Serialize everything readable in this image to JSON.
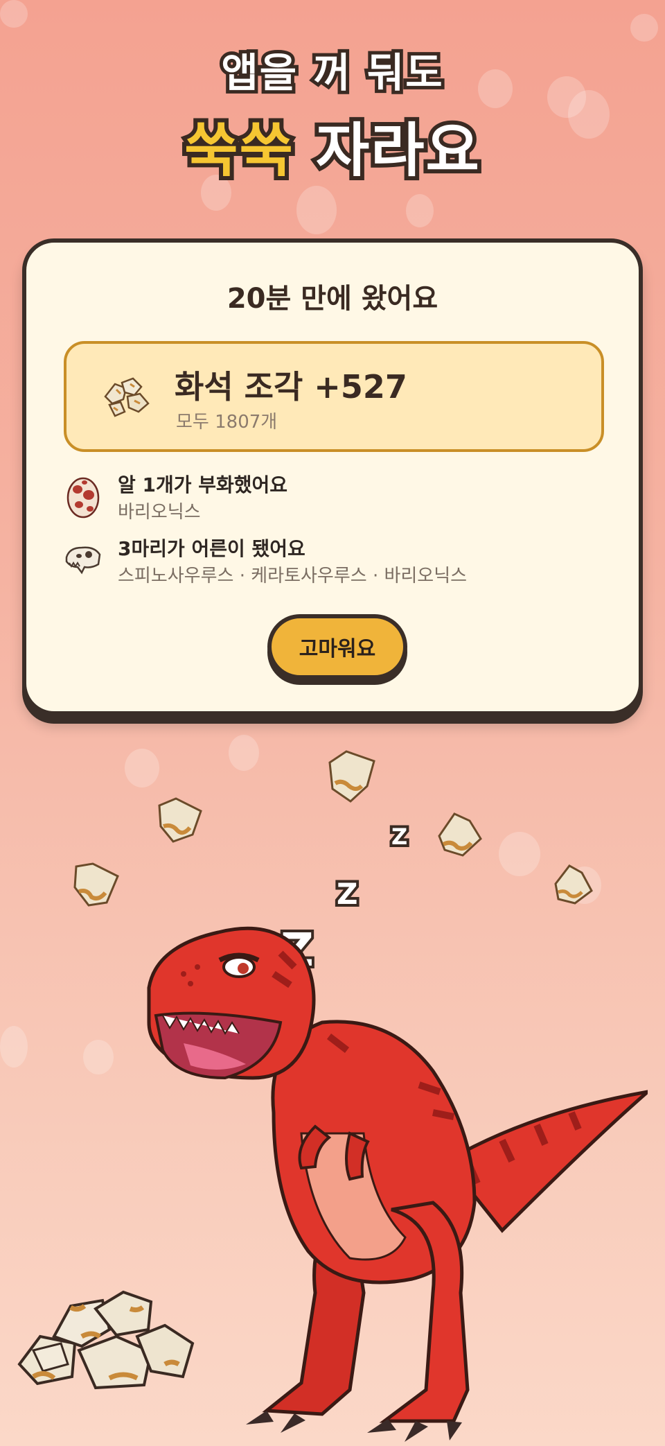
{
  "headline": {
    "line1": "앱을 꺼 둬도",
    "line2_highlight": "쑥쑥",
    "line2_rest": "자라요"
  },
  "card": {
    "title": "20분 만에 왔어요",
    "reward": {
      "icon": "fossil-piece-icon",
      "amount_label": "화석 조각 +527",
      "total_label": "모두 1807개"
    },
    "events": [
      {
        "icon": "egg-icon",
        "title": "알 1개가 부화했어요",
        "subtitle": "바리오닉스"
      },
      {
        "icon": "dino-skull-icon",
        "title": "3마리가 어른이 됐어요",
        "subtitle": "스피노사우루스 · 케라토사우루스 · 바리오닉스"
      }
    ],
    "button_label": "고마워요"
  },
  "sleep": {
    "z_large": "Z",
    "z_medium": "Z",
    "z_small": "Z"
  },
  "colors": {
    "background_top": "#f4a291",
    "background_bottom": "#fbd8c8",
    "card_bg": "#fff8e6",
    "reward_bg": "#ffe9b8",
    "reward_border": "#c98f27",
    "button": "#f0b43a",
    "outline": "#3a2e28",
    "headline_highlight": "#f6c632",
    "dino": "#e0362c"
  }
}
